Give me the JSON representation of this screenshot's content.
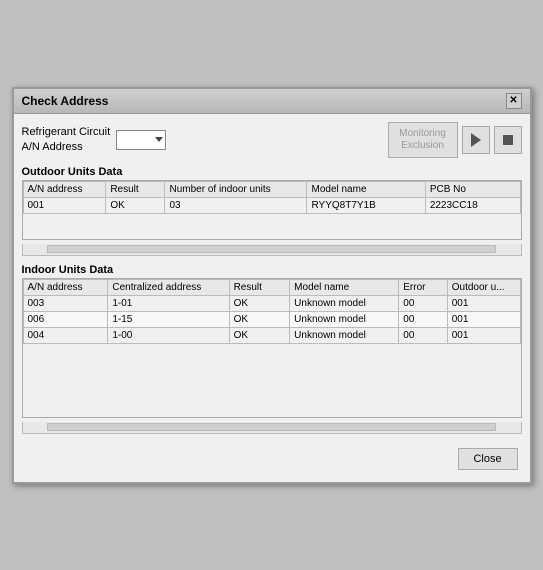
{
  "window": {
    "title": "Check Address",
    "close_label": "✕"
  },
  "controls": {
    "label_line1": "Refrigerant Circuit",
    "label_line2": "A/N Address",
    "monitoring_exclusion_label": "Monitoring\nExclusion",
    "play_label": "▶",
    "stop_label": "■"
  },
  "outdoor_section": {
    "label": "Outdoor Units Data",
    "columns": [
      "A/N address",
      "Result",
      "Number of indoor units",
      "Model name",
      "PCB No"
    ],
    "column_widths": [
      "70",
      "50",
      "120",
      "100",
      "80"
    ],
    "rows": [
      [
        "001",
        "OK",
        "03",
        "RYYQ8T7Y1B",
        "2223CC18"
      ]
    ]
  },
  "indoor_section": {
    "label": "Indoor Units Data",
    "columns": [
      "A/N address",
      "Centralized address",
      "Result",
      "Model name",
      "Error",
      "Outdoor u..."
    ],
    "column_widths": [
      "70",
      "100",
      "50",
      "90",
      "40",
      "60"
    ],
    "rows": [
      [
        "003",
        "1-01",
        "OK",
        "Unknown model",
        "00",
        "001"
      ],
      [
        "006",
        "1-15",
        "OK",
        "Unknown model",
        "00",
        "001"
      ],
      [
        "004",
        "1-00",
        "OK",
        "Unknown model",
        "00",
        "001"
      ]
    ]
  },
  "footer": {
    "close_label": "Close"
  }
}
